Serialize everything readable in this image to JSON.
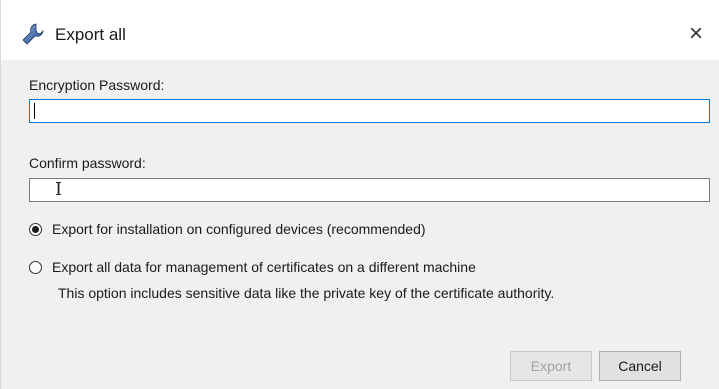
{
  "window": {
    "title": "Export all",
    "close_glyph": "×",
    "title_icon": "wrench-tool-icon"
  },
  "form": {
    "encryption_label": "Encryption Password:",
    "encryption_value": "",
    "confirm_label": "Confirm password:",
    "confirm_value": ""
  },
  "options": [
    {
      "label": "Export for installation on configured devices (recommended)",
      "checked": true
    },
    {
      "label": "Export all data for management of certificates on a different machine",
      "checked": false,
      "description": "This option includes sensitive data like the private key of the certificate authority."
    }
  ],
  "buttons": {
    "export_label": "Export",
    "export_enabled": false,
    "cancel_label": "Cancel"
  },
  "colors": {
    "focus_border": "#0078d7",
    "dialog_bg": "#f0f0f0",
    "disabled_text": "#a0a0a0"
  }
}
